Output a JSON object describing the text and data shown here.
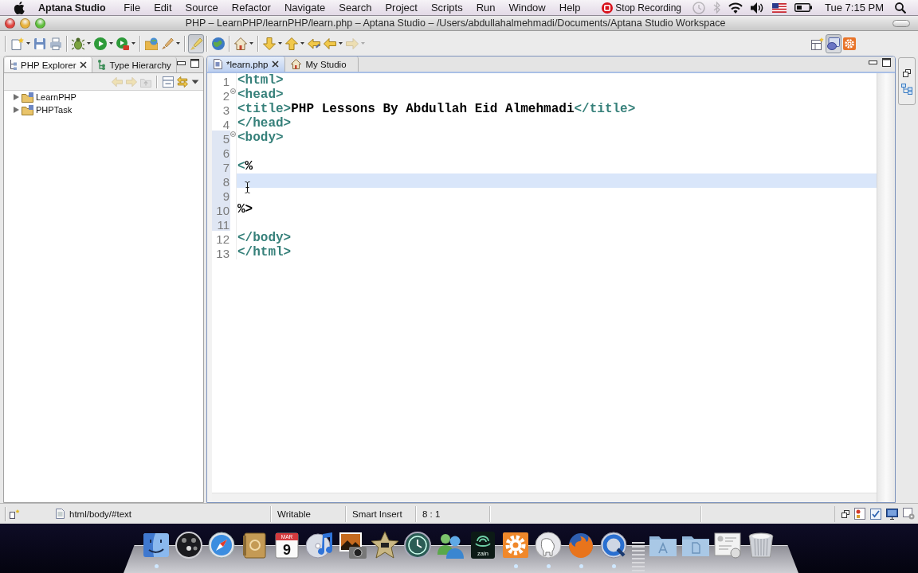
{
  "menu_bar": {
    "app_name": "Aptana Studio",
    "menus": [
      "File",
      "Edit",
      "Source",
      "Refactor",
      "Navigate",
      "Search",
      "Project",
      "Scripts",
      "Run",
      "Window",
      "Help"
    ],
    "recording": "Stop Recording",
    "status_icons": [
      {
        "kind": "time-machine",
        "disabled": true
      },
      {
        "kind": "bluetooth",
        "disabled": true
      },
      {
        "kind": "wifi",
        "disabled": false
      },
      {
        "kind": "volume",
        "disabled": false
      },
      {
        "kind": "flag",
        "disabled": false
      },
      {
        "kind": "battery",
        "disabled": false
      }
    ],
    "clock": "Tue 7:15 PM"
  },
  "window": {
    "title": "PHP – LearnPHP/learnPHP/learn.php – Aptana Studio – /Users/abdullahalmehmadi/Documents/Aptana Studio Workspace"
  },
  "toolbar": {
    "groups": [
      [
        {
          "kind": "new",
          "dropdown": true,
          "pressed": false,
          "disabled": false
        },
        {
          "kind": "save",
          "dropdown": false,
          "pressed": false,
          "disabled": false
        },
        {
          "kind": "print",
          "dropdown": false,
          "pressed": false,
          "disabled": false
        }
      ],
      [
        {
          "kind": "debug",
          "dropdown": true,
          "pressed": false,
          "disabled": false
        },
        {
          "kind": "run",
          "dropdown": true,
          "pressed": false,
          "disabled": false
        },
        {
          "kind": "external-tools",
          "dropdown": true,
          "pressed": false,
          "disabled": false
        }
      ],
      [
        {
          "kind": "open-type",
          "dropdown": false,
          "pressed": false,
          "disabled": false
        },
        {
          "kind": "brush",
          "dropdown": true,
          "pressed": false,
          "disabled": false
        }
      ],
      [
        {
          "kind": "mark-occurrences",
          "dropdown": false,
          "pressed": true,
          "disabled": false
        }
      ],
      [
        {
          "kind": "globe",
          "dropdown": false,
          "pressed": false,
          "disabled": false
        }
      ],
      [
        {
          "kind": "home",
          "dropdown": true,
          "pressed": false,
          "disabled": false
        }
      ],
      [
        {
          "kind": "next-annotation",
          "dropdown": true,
          "pressed": false,
          "disabled": false
        },
        {
          "kind": "previous-annotation",
          "dropdown": true,
          "pressed": false,
          "disabled": false
        },
        {
          "kind": "last-edit",
          "dropdown": false,
          "pressed": false,
          "disabled": false
        },
        {
          "kind": "back",
          "dropdown": true,
          "pressed": false,
          "disabled": false
        },
        {
          "kind": "forward",
          "dropdown": true,
          "pressed": false,
          "disabled": true
        }
      ]
    ],
    "perspectives": [
      {
        "kind": "open-perspective",
        "selected": false
      },
      {
        "kind": "php",
        "selected": true
      },
      {
        "kind": "aptana",
        "selected": false
      }
    ]
  },
  "views": {
    "tabs": [
      {
        "label": "PHP Explorer",
        "selected": true
      },
      {
        "label": "Type Hierarchy",
        "selected": false
      }
    ],
    "toolbar": [
      {
        "kind": "back",
        "disabled": true
      },
      {
        "kind": "forward",
        "disabled": true
      },
      {
        "kind": "up",
        "disabled": true
      },
      {
        "kind": "collapse-all",
        "disabled": false
      },
      {
        "kind": "link-editor",
        "disabled": false
      },
      {
        "kind": "view-menu",
        "disabled": false
      }
    ],
    "tree": [
      {
        "label": "LearnPHP",
        "expanded": false
      },
      {
        "label": "PHPTask",
        "expanded": false
      }
    ]
  },
  "editor": {
    "tabs": [
      {
        "label": "*learn.php",
        "kind": "php-file",
        "selected": true
      },
      {
        "label": "My Studio",
        "kind": "studio",
        "selected": false
      }
    ],
    "lines": [
      {
        "number": "1",
        "segments": [
          {
            "text": "<html>",
            "kind": "tag"
          }
        ],
        "fold": false,
        "in_range": false,
        "current": false
      },
      {
        "number": "2",
        "segments": [
          {
            "text": "<head>",
            "kind": "tag"
          }
        ],
        "fold": true,
        "in_range": false,
        "current": false
      },
      {
        "number": "3",
        "segments": [
          {
            "text": "<title>",
            "kind": "tag"
          },
          {
            "text": "PHP Lessons By Abdullah Eid Almehmadi",
            "kind": "text"
          },
          {
            "text": "</title>",
            "kind": "tag"
          }
        ],
        "fold": false,
        "in_range": false,
        "current": false
      },
      {
        "number": "4",
        "segments": [
          {
            "text": "</head>",
            "kind": "tag"
          }
        ],
        "fold": false,
        "in_range": false,
        "current": false
      },
      {
        "number": "5",
        "segments": [
          {
            "text": "<body>",
            "kind": "tag"
          }
        ],
        "fold": true,
        "in_range": true,
        "current": false
      },
      {
        "number": "6",
        "fold": false,
        "in_range": true,
        "current": false
      },
      {
        "number": "7",
        "segments": [
          {
            "text": "<",
            "kind": "tag"
          },
          {
            "text": "%",
            "kind": "text"
          }
        ],
        "fold": false,
        "in_range": true,
        "current": false
      },
      {
        "number": "8",
        "fold": false,
        "in_range": true,
        "current": true
      },
      {
        "number": "9",
        "fold": false,
        "in_range": true,
        "current": false
      },
      {
        "number": "10",
        "segments": [
          {
            "text": "%>",
            "kind": "text"
          }
        ],
        "fold": false,
        "in_range": true,
        "current": false
      },
      {
        "number": "11",
        "fold": false,
        "in_range": true,
        "current": false
      },
      {
        "number": "12",
        "segments": [
          {
            "text": "</body>",
            "kind": "tag"
          }
        ],
        "fold": false,
        "in_range": false,
        "current": false
      },
      {
        "number": "13",
        "segments": [
          {
            "text": "</html>",
            "kind": "tag"
          }
        ],
        "fold": false,
        "in_range": false,
        "current": false
      }
    ]
  },
  "status_bar": {
    "path": "html/body/#text",
    "mode": "Writable",
    "insert": "Smart Insert",
    "position": "8 : 1"
  },
  "dock": {
    "items": [
      {
        "kind": "finder",
        "running": true
      },
      {
        "kind": "dashboard",
        "running": false
      },
      {
        "kind": "safari",
        "running": false
      },
      {
        "kind": "address-book",
        "running": false
      },
      {
        "kind": "calendar",
        "month": "MAR",
        "text": "9",
        "running": false
      },
      {
        "kind": "itunes",
        "running": false
      },
      {
        "kind": "iphoto",
        "running": false
      },
      {
        "kind": "imovie",
        "running": false
      },
      {
        "kind": "time-machine",
        "running": false
      },
      {
        "kind": "messenger",
        "running": false
      },
      {
        "kind": "carrier",
        "text": "zain",
        "running": false
      },
      {
        "kind": "gear",
        "running": true
      },
      {
        "kind": "elephant",
        "running": true
      },
      {
        "kind": "firefox",
        "running": true
      },
      {
        "kind": "quicktime",
        "running": true
      },
      {
        "kind": "separator",
        "running": false
      },
      {
        "kind": "apps-folder",
        "running": false
      },
      {
        "kind": "docs-folder",
        "running": false
      },
      {
        "kind": "mamp",
        "running": false
      },
      {
        "kind": "trash",
        "running": false
      }
    ]
  }
}
